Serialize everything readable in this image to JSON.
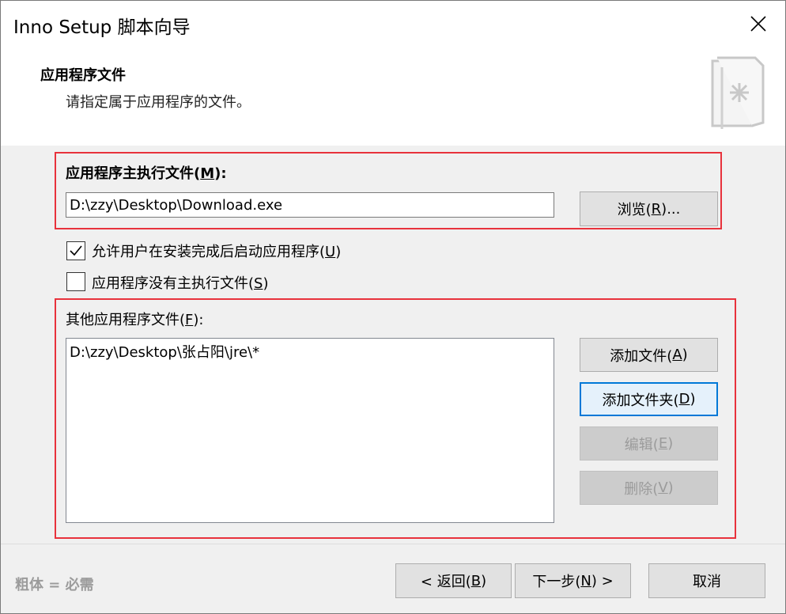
{
  "window": {
    "title": "Inno Setup 脚本向导"
  },
  "header": {
    "title": "应用程序文件",
    "subtitle": "请指定属于应用程序的文件。"
  },
  "main_exe": {
    "label_prefix": "应用程序主执行文件(",
    "label_key": "M",
    "label_suffix": "):",
    "value": "D:\\zzy\\Desktop\\Download.exe",
    "browse_prefix": "浏览(",
    "browse_key": "R",
    "browse_suffix": ")..."
  },
  "options": {
    "allow_start_prefix": "允许用户在安装完成后启动应用程序(",
    "allow_start_key": "U",
    "allow_start_suffix": ")",
    "allow_start_checked": true,
    "no_main_prefix": "应用程序没有主执行文件(",
    "no_main_key": "S",
    "no_main_suffix": ")",
    "no_main_checked": false
  },
  "other_files": {
    "label_prefix": "其他应用程序文件(",
    "label_key": "F",
    "label_suffix": "):",
    "items": [
      "D:\\zzy\\Desktop\\张占阳\\jre\\*"
    ],
    "buttons": {
      "add_file_prefix": "添加文件(",
      "add_file_key": "A",
      "add_file_suffix": ")",
      "add_folder_prefix": "添加文件夹(",
      "add_folder_key": "D",
      "add_folder_suffix": ")",
      "edit_prefix": "编辑(",
      "edit_key": "E",
      "edit_suffix": ")",
      "remove_prefix": "删除(",
      "remove_key": "V",
      "remove_suffix": ")"
    }
  },
  "footer": {
    "note": "粗体 = 必需",
    "back_prefix": "< 返回(",
    "back_key": "B",
    "back_suffix": ")",
    "next_prefix": "下一步(",
    "next_key": "N",
    "next_suffix": ") >",
    "cancel": "取消"
  },
  "colors": {
    "highlight_box": "#e8323c",
    "focus_border": "#0078d7"
  }
}
